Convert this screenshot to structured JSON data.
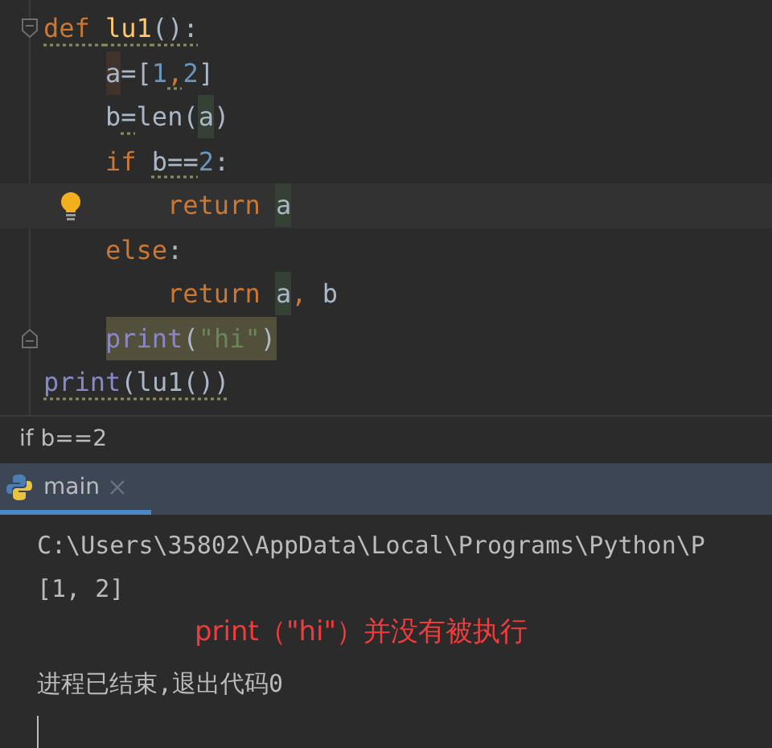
{
  "editor": {
    "lines": [
      {
        "fold_start": true,
        "tokens": [
          {
            "text": "def ",
            "kind": "keyword",
            "warning": true
          },
          {
            "text": "lu1",
            "kind": "function",
            "warning": true
          },
          {
            "text": "():",
            "kind": "plain",
            "warning": true
          }
        ],
        "children": [
          {
            "tokens": [
              {
                "text": "a",
                "kind": "plain",
                "definition": true
              },
              {
                "text": "=[",
                "kind": "plain"
              },
              {
                "text": "1",
                "kind": "number"
              },
              {
                "text": ",",
                "kind": "keyword",
                "warning": true
              },
              {
                "text": "2",
                "kind": "number"
              },
              {
                "text": "]",
                "kind": "plain"
              }
            ]
          },
          {
            "tokens": [
              {
                "text": "b",
                "kind": "plain"
              },
              {
                "text": "=",
                "kind": "plain",
                "warning": true
              },
              {
                "text": "len(",
                "kind": "plain"
              },
              {
                "text": "a",
                "kind": "plain",
                "usage": true
              },
              {
                "text": ")",
                "kind": "plain"
              }
            ]
          },
          {
            "tokens": [
              {
                "text": "if ",
                "kind": "keyword"
              },
              {
                "text": "b==",
                "kind": "plain",
                "warning": true
              },
              {
                "text": "2",
                "kind": "number"
              },
              {
                "text": ":",
                "kind": "plain"
              }
            ],
            "children": [
              {
                "bulb": true,
                "current": true,
                "tokens": [
                  {
                    "text": "return ",
                    "kind": "keyword"
                  },
                  {
                    "text": "a",
                    "kind": "plain",
                    "usage": true
                  }
                ]
              }
            ]
          },
          {
            "tokens": [
              {
                "text": "else",
                "kind": "keyword"
              },
              {
                "text": ":",
                "kind": "plain"
              }
            ],
            "children": [
              {
                "tokens": [
                  {
                    "text": "return ",
                    "kind": "keyword"
                  },
                  {
                    "text": "a",
                    "kind": "plain",
                    "usage": true
                  },
                  {
                    "text": ", ",
                    "kind": "keyword"
                  },
                  {
                    "text": "b",
                    "kind": "plain"
                  }
                ]
              }
            ]
          },
          {
            "fold_end": true,
            "tokens": [
              {
                "text": "print",
                "kind": "builtin",
                "in_selection": true
              },
              {
                "text": "(",
                "kind": "plain",
                "in_selection": true
              },
              {
                "text": "\"hi\"",
                "kind": "string",
                "in_selection": true
              },
              {
                "text": ")",
                "kind": "plain",
                "in_selection": true
              }
            ]
          }
        ]
      },
      {
        "tokens": [
          {
            "text": "print",
            "kind": "builtin",
            "warning": true
          },
          {
            "text": "(lu1())",
            "kind": "plain",
            "warning": true
          }
        ]
      }
    ]
  },
  "breadcrumb": "if b==2",
  "run_tabs": [
    {
      "label": "main",
      "selected": true
    }
  ],
  "console": {
    "lines": [
      "C:\\Users\\35802\\AppData\\Local\\Programs\\Python\\P",
      "[1, 2]"
    ],
    "annotation": "print（\"hi\"）并没有被执行",
    "exit_line": "进程已结束,退出代码0"
  }
}
